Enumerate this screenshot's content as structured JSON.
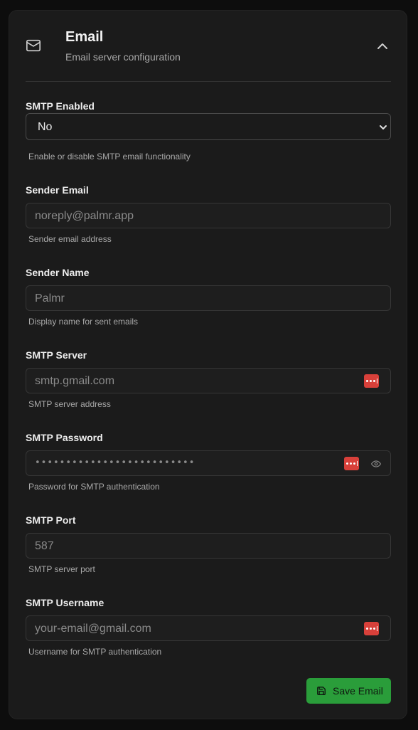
{
  "header": {
    "title": "Email",
    "subtitle": "Email server configuration",
    "icon": "mail-icon",
    "collapse_icon": "chevron-up-icon"
  },
  "fields": {
    "smtp_enabled": {
      "label": "SMTP Enabled",
      "value": "No",
      "options": [
        "No"
      ],
      "help": "Enable or disable SMTP email functionality"
    },
    "sender_email": {
      "label": "Sender Email",
      "placeholder": "noreply@palmr.app",
      "help": "Sender email address"
    },
    "sender_name": {
      "label": "Sender Name",
      "placeholder": "Palmr",
      "help": "Display name for sent emails"
    },
    "smtp_server": {
      "label": "SMTP Server",
      "placeholder": "smtp.gmail.com",
      "help": "SMTP server address"
    },
    "smtp_password": {
      "label": "SMTP Password",
      "masked_value": "••••••••••••••••••••••••••",
      "help": "Password for SMTP authentication"
    },
    "smtp_port": {
      "label": "SMTP Port",
      "placeholder": "587",
      "help": "SMTP server port"
    },
    "smtp_username": {
      "label": "SMTP Username",
      "placeholder": "your-email@gmail.com",
      "help": "Username for SMTP authentication"
    }
  },
  "actions": {
    "save_label": "Save Email",
    "save_icon": "save-icon"
  },
  "colors": {
    "accent_green": "#2a9d3a",
    "password_manager_red": "#d8403a",
    "card_bg": "#1b1b1b"
  }
}
